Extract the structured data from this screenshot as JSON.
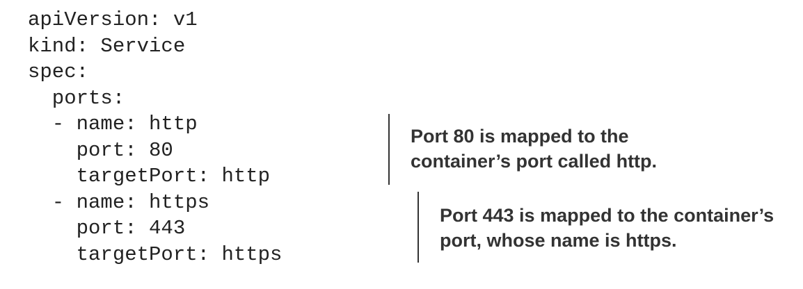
{
  "code": {
    "lines": [
      "apiVersion: v1",
      "kind: Service",
      "spec:",
      "  ports:",
      "  - name: http",
      "    port: 80",
      "    targetPort: http",
      "  - name: https",
      "    port: 443",
      "    targetPort: https"
    ]
  },
  "annotations": [
    {
      "lines": [
        "Port 80 is mapped to the",
        "container’s port called http."
      ]
    },
    {
      "lines": [
        "Port 443 is mapped to the container’s",
        "port, whose name is https."
      ]
    }
  ]
}
